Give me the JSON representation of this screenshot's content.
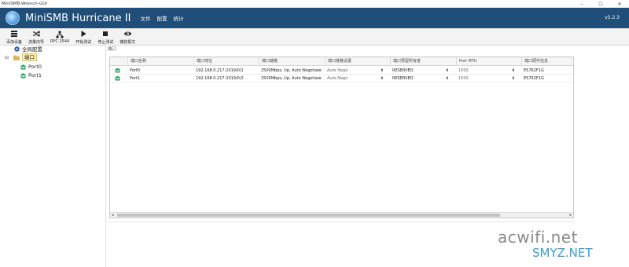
{
  "window": {
    "title": "MiniSMB-Wrench-GUI"
  },
  "app": {
    "name": "MiniSMB Hurricane II",
    "version": "v5.2.3"
  },
  "menu": [
    "文件",
    "配置",
    "统计"
  ],
  "toolbar": [
    {
      "label": "添加设备",
      "icon": "server-icon"
    },
    {
      "label": "流量向导",
      "icon": "shuffle-icon"
    },
    {
      "label": "RFC 2544",
      "icon": "network-icon"
    },
    {
      "label": "开始测试",
      "icon": "play-icon"
    },
    {
      "label": "停止测试",
      "icon": "stop-icon"
    },
    {
      "label": "捕获报文",
      "icon": "eye-icon"
    }
  ],
  "tree": {
    "global": "全局配置",
    "ports_root": "端口",
    "ports": [
      "Port0",
      "Port1"
    ]
  },
  "content": {
    "section_label": "端口",
    "columns": [
      "端口名称",
      "端口地址",
      "端口链路",
      "端口链路设置",
      "端口预留所有者",
      "Port MTU",
      "端口硬件信息"
    ],
    "rows": [
      {
        "name": "Port0",
        "address": "192.168.0.217:2019/0/1",
        "link": "2500Mbps, Up, Auto Negotiate",
        "link_setting": "Auto Nego",
        "owner": "RESERVED",
        "mtu": "1500",
        "hw": "E5762F1G"
      },
      {
        "name": "Port1",
        "address": "192.168.0.217:2019/0/2",
        "link": "2500Mbps, Up, Auto Negotiate",
        "link_setting": "Auto Nego",
        "owner": "RESERVED",
        "mtu": "1500",
        "hw": "E5762F1G"
      }
    ]
  },
  "watermark": {
    "line1": "acwifi.net",
    "line2": "SMYZ.NET"
  },
  "colors": {
    "header": "#1f4e79",
    "selection": "#fff3b0",
    "port_icon": "#2e9e6a",
    "watermark_blue": "#3a9bd8"
  }
}
